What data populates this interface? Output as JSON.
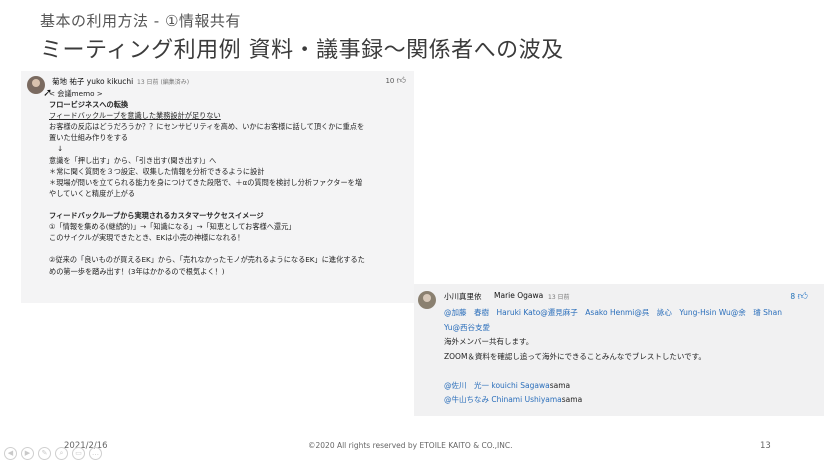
{
  "slide": {
    "subtitle": "基本の利用方法 - ①情報共有",
    "title": "ミーティング利用例 資料・議事録～関係者への波及"
  },
  "post": {
    "author": "菊地 祐子 yuko kikuchi",
    "meta": "13 日前 (編集済み)",
    "likes": "10",
    "lines": [
      "< 会議memo >",
      "フロービジネスへの転換",
      "フィードバックループを意識した業務設計が足りない",
      "お客様の反応はどうだろうか？？にセンサビリティを高め、いかにお客様に話して頂くかに重点を",
      "置いた仕組み作りをする",
      "↓",
      "意識を「押し出す」から、「引き出す(聞き出す)」へ",
      "＊常に聞く質問を３つ設定、収集した情報を分析できるように設計",
      "＊現場が問いを立てられる能力を身につけてきた段階で、＋αの質問を検討し分析ファクターを増",
      "やしていくと精度が上がる",
      "フィードバックループから実現されるカスタマーサクセスイメージ",
      "①「情報を集める(継続的)」→「知識になる」→「知恵としてお客様へ還元」",
      "このサイクルが実現できたとき、EKは小売の神様になれる！",
      "②従来の「良いものが買えるEK」から、「売れなかったモノが売れるようになるEK」に進化するた",
      "めの第一歩を踏み出す！(3年はかかるので根気よく！)"
    ]
  },
  "reply": {
    "author": "小川真里依",
    "author_en": "Marie Ogawa",
    "meta": "13 日前",
    "likes": "8",
    "mentions_line1": "@加藤　春樹　Haruki Kato@遷見麻子　Asako Henmi@呉　詠心　Yung-Hsin Wu@余　璿 Shan",
    "mentions_line2": "Yu@西谷支愛",
    "text1": "海外メンバー共有します。",
    "text2": "ZOOM＆資料を確認し追って海外にできることみんなでブレストしたいです。",
    "mention3": "@佐川　光一 kouichi Sagawa",
    "mention3_suffix": "sama",
    "mention4": "@牛山ちなみ Chinami Ushiyama",
    "mention4_suffix": "sama"
  },
  "footer": {
    "date": "2021/2/16",
    "copyright": "©2020 All rights reserved by ETOILE KAITO & CO.,INC.",
    "page": "13"
  },
  "icons": {
    "like": "thumbs-up-icon",
    "nav": [
      "prev-icon",
      "next-icon",
      "pen-icon",
      "search-icon",
      "slides-icon",
      "more-icon"
    ]
  }
}
